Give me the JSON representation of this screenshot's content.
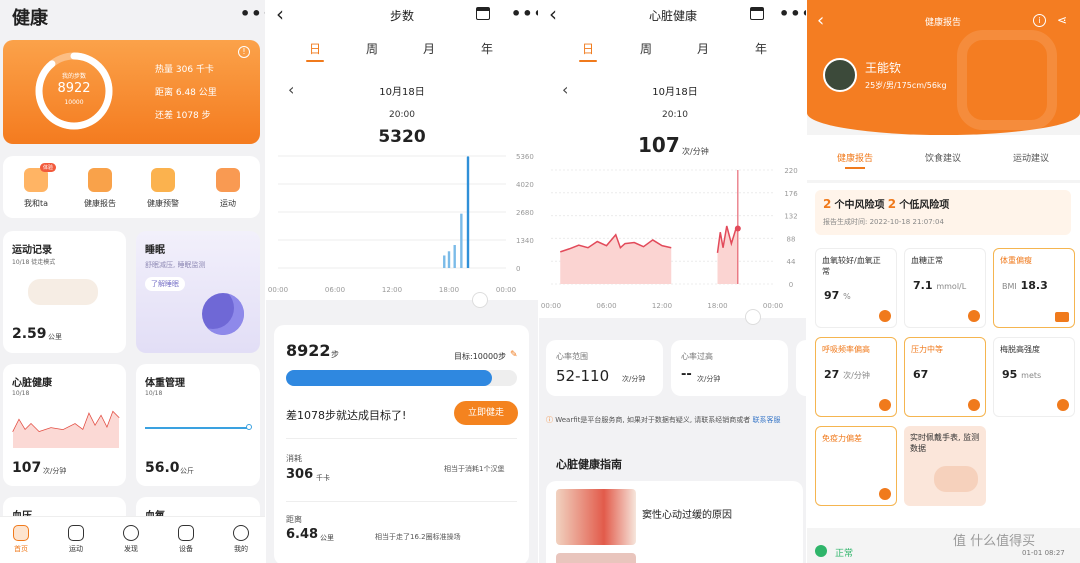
{
  "home": {
    "title": "健康",
    "more": "•••",
    "ring": {
      "label": "我的步数",
      "value": "8922",
      "goal": "10000",
      "progress": 0.89
    },
    "stats": [
      "热量 306 千卡",
      "距离 6.48 公里",
      "还差 1078 步"
    ],
    "info": "!",
    "quick": [
      {
        "label": "我和ta",
        "icon": "couple-icon",
        "badge": "体验"
      },
      {
        "label": "健康报告",
        "icon": "report-icon"
      },
      {
        "label": "健康预警",
        "icon": "warning-icon"
      },
      {
        "label": "运动",
        "icon": "run-icon"
      }
    ],
    "exercise": {
      "title": "运动记录",
      "subtitle": "10/18 徒走模式",
      "value": "2.59",
      "unit": "公里"
    },
    "sleep": {
      "title": "睡眠",
      "subtitle": "舒眠减压, 睡眠监测",
      "button": "了解睡眠"
    },
    "heart": {
      "title": "心脏健康",
      "date": "10/18",
      "value": "107",
      "unit": "次/分钟"
    },
    "weight": {
      "title": "体重管理",
      "date": "10/18",
      "value": "56.0",
      "unit": "公斤"
    },
    "bp": {
      "title": "血压"
    },
    "spo2": {
      "title": "血氧"
    },
    "nav": [
      "首页",
      "运动",
      "发现",
      "设备",
      "我的"
    ]
  },
  "steps": {
    "title": "步数",
    "tabs": [
      "日",
      "周",
      "月",
      "年"
    ],
    "date": "10月18日",
    "time": "20:00",
    "value": "5320",
    "total": "8922",
    "total_unit": "步",
    "goal": "目标:10000步",
    "progress": 0.8922,
    "remaining": "差1078步就达成目标了!",
    "go_button": "立即健走",
    "cal_label": "消耗",
    "cal_value": "306",
    "cal_unit": "千卡",
    "cal_note": "相当于消耗1个汉堡",
    "dist_label": "距离",
    "dist_value": "6.48",
    "dist_unit": "公里",
    "dist_note": "相当于走了16.2圈标准操场"
  },
  "heart": {
    "title": "心脏健康",
    "tabs": [
      "日",
      "周",
      "月",
      "年"
    ],
    "date": "10月18日",
    "time": "20:10",
    "value": "107",
    "unit": "次/分钟",
    "range_label": "心率范围",
    "range_value": "52-110",
    "range_unit": "次/分钟",
    "high_label": "心率过高",
    "high_value": "--",
    "high_unit": "次/分钟",
    "disclaimer": "Wearfit是平台服务商, 如果对于数据有疑义, 请联系经销商或者",
    "disclaimer_link": "联系客服",
    "guide_title": "心脏健康指南",
    "article": "窦性心动过缓的原因"
  },
  "report": {
    "title": "健康报告",
    "name": "王能钦",
    "profile": "25岁/男/175cm/56kg",
    "tabs": [
      "健康报告",
      "饮食建议",
      "运动建议"
    ],
    "summary_mid_count": "2",
    "summary_mid": "个中风险项",
    "summary_low_count": "2",
    "summary_low": "个低风险项",
    "time": "报告生成时间: 2022-10-18 21:07:04",
    "cards": [
      {
        "label": "血氧较好/血氧正常",
        "value": "97",
        "unit": "%",
        "warn": false
      },
      {
        "label": "血糖正常",
        "value": "7.1",
        "unit": "mmol/L",
        "warn": false
      },
      {
        "label": "体重偏瘦",
        "value": "18.3",
        "unit": "BMI",
        "warn": true
      },
      {
        "label": "呼吸频率偏高",
        "value": "27",
        "unit": "次/分钟",
        "warn": true
      },
      {
        "label": "压力中等",
        "value": "67",
        "unit": "",
        "warn": true
      },
      {
        "label": "梅脱高强度",
        "value": "95",
        "unit": "mets",
        "warn": false
      },
      {
        "label": "免疫力偏差",
        "value": "",
        "unit": "",
        "warn": true
      }
    ],
    "wear_tip": "实时佩戴手表, 监测数据",
    "status": "正常",
    "stamp": "01-01 08:27",
    "watermark": "值 什么值得买"
  },
  "chart_data": [
    {
      "type": "bar",
      "x_ticks": [
        "00:00",
        "06:00",
        "12:00",
        "18:00",
        "00:00"
      ],
      "y_ticks": [
        0,
        1340,
        2680,
        4020,
        5360
      ],
      "ylim": [
        0,
        5360
      ],
      "x_hours": [
        19.25,
        19.5,
        19.75,
        20.0
      ],
      "values": [
        600,
        800,
        1100,
        2600,
        5320
      ],
      "bar_hours": [
        17.5,
        18.0,
        18.6,
        19.3,
        20.0
      ]
    },
    {
      "type": "area",
      "x_ticks": [
        "00:00",
        "06:00",
        "12:00",
        "18:00",
        "00:00"
      ],
      "y_ticks": [
        0,
        44,
        88,
        132,
        176,
        220
      ],
      "ylim": [
        0,
        220
      ],
      "segment1_hours": [
        1.0,
        2.0,
        3.0,
        4.0,
        5.0,
        6.0,
        7.0,
        7.5,
        8.0,
        9.0,
        10.0,
        11.0,
        12.0,
        13.0
      ],
      "segment1_values": [
        62,
        68,
        75,
        70,
        82,
        74,
        95,
        70,
        78,
        80,
        72,
        85,
        74,
        70
      ],
      "segment2_hours": [
        18.0,
        18.3,
        18.6,
        19.0,
        19.5,
        20.0,
        20.2
      ],
      "segment2_values": [
        60,
        100,
        70,
        112,
        78,
        107,
        107
      ]
    }
  ]
}
